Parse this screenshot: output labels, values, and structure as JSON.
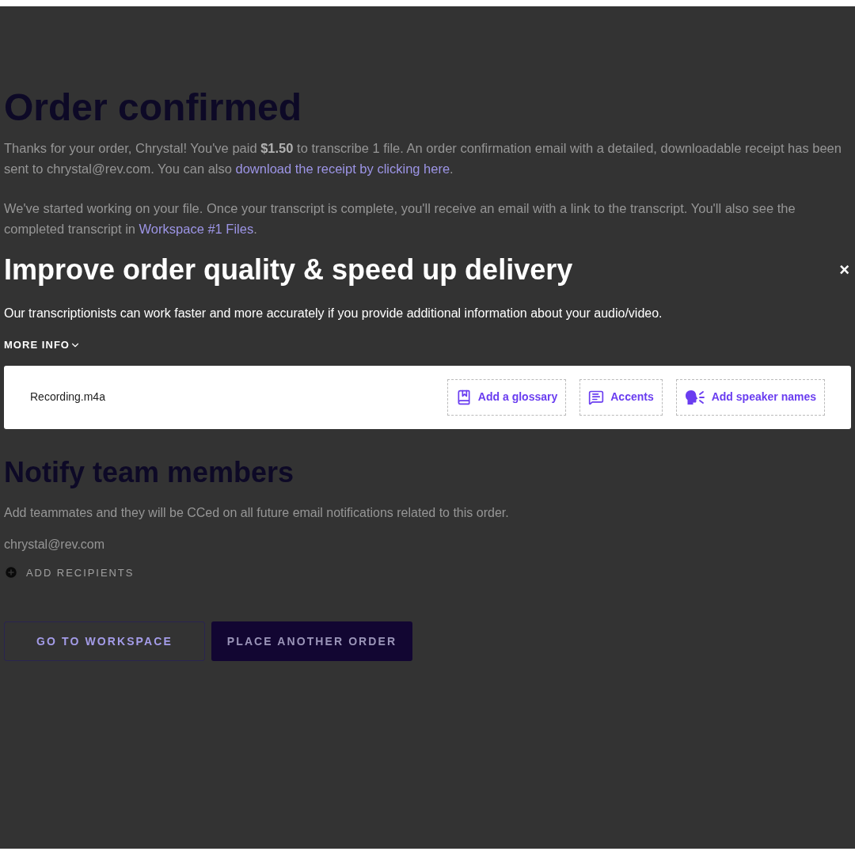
{
  "page": {
    "title": "Order confirmed",
    "paragraphs": [
      [
        {
          "kind": "text",
          "text": "Thanks for your order, Chrystal!  You've paid "
        },
        {
          "kind": "bold",
          "text": "$1.50"
        },
        {
          "kind": "text",
          "text": " to transcribe 1 file. An order confirmation email with a detailed, downloadable receipt has been sent to chrystal@rev.com. You can also "
        },
        {
          "kind": "link",
          "text": "download the receipt by clicking here"
        },
        {
          "kind": "text",
          "text": "."
        }
      ],
      [
        {
          "kind": "text",
          "text": "We've started working on your file. Once your transcript is complete, you'll receive an email with a link to the transcript. You'll also see the completed transcript in "
        },
        {
          "kind": "link",
          "text": "Workspace #1 Files"
        },
        {
          "kind": "text",
          "text": "."
        }
      ]
    ],
    "notify": {
      "title": "Notify team members",
      "description": "Add teammates and they will be CCed on all future email notifications related to this order.",
      "email": "chrystal@rev.com",
      "add_label": "ADD RECIPIENTS"
    },
    "buttons": [
      {
        "kind": "outline",
        "label": "GO TO WORKSPACE"
      },
      {
        "kind": "filled",
        "label": "PLACE ANOTHER ORDER"
      }
    ]
  },
  "dialog": {
    "title": "Improve order quality & speed up delivery",
    "close": "×",
    "description": "Our transcriptionists can work faster and more accurately if you provide additional information about your audio/video.",
    "more_info": "MORE INFO",
    "expanded": false,
    "file": {
      "name": "Recording.m4a",
      "actions": [
        {
          "kind": "glossary",
          "label": "Add a glossary"
        },
        {
          "kind": "accents",
          "label": "Accents"
        },
        {
          "kind": "speakers",
          "label": "Add speaker names"
        }
      ]
    }
  }
}
